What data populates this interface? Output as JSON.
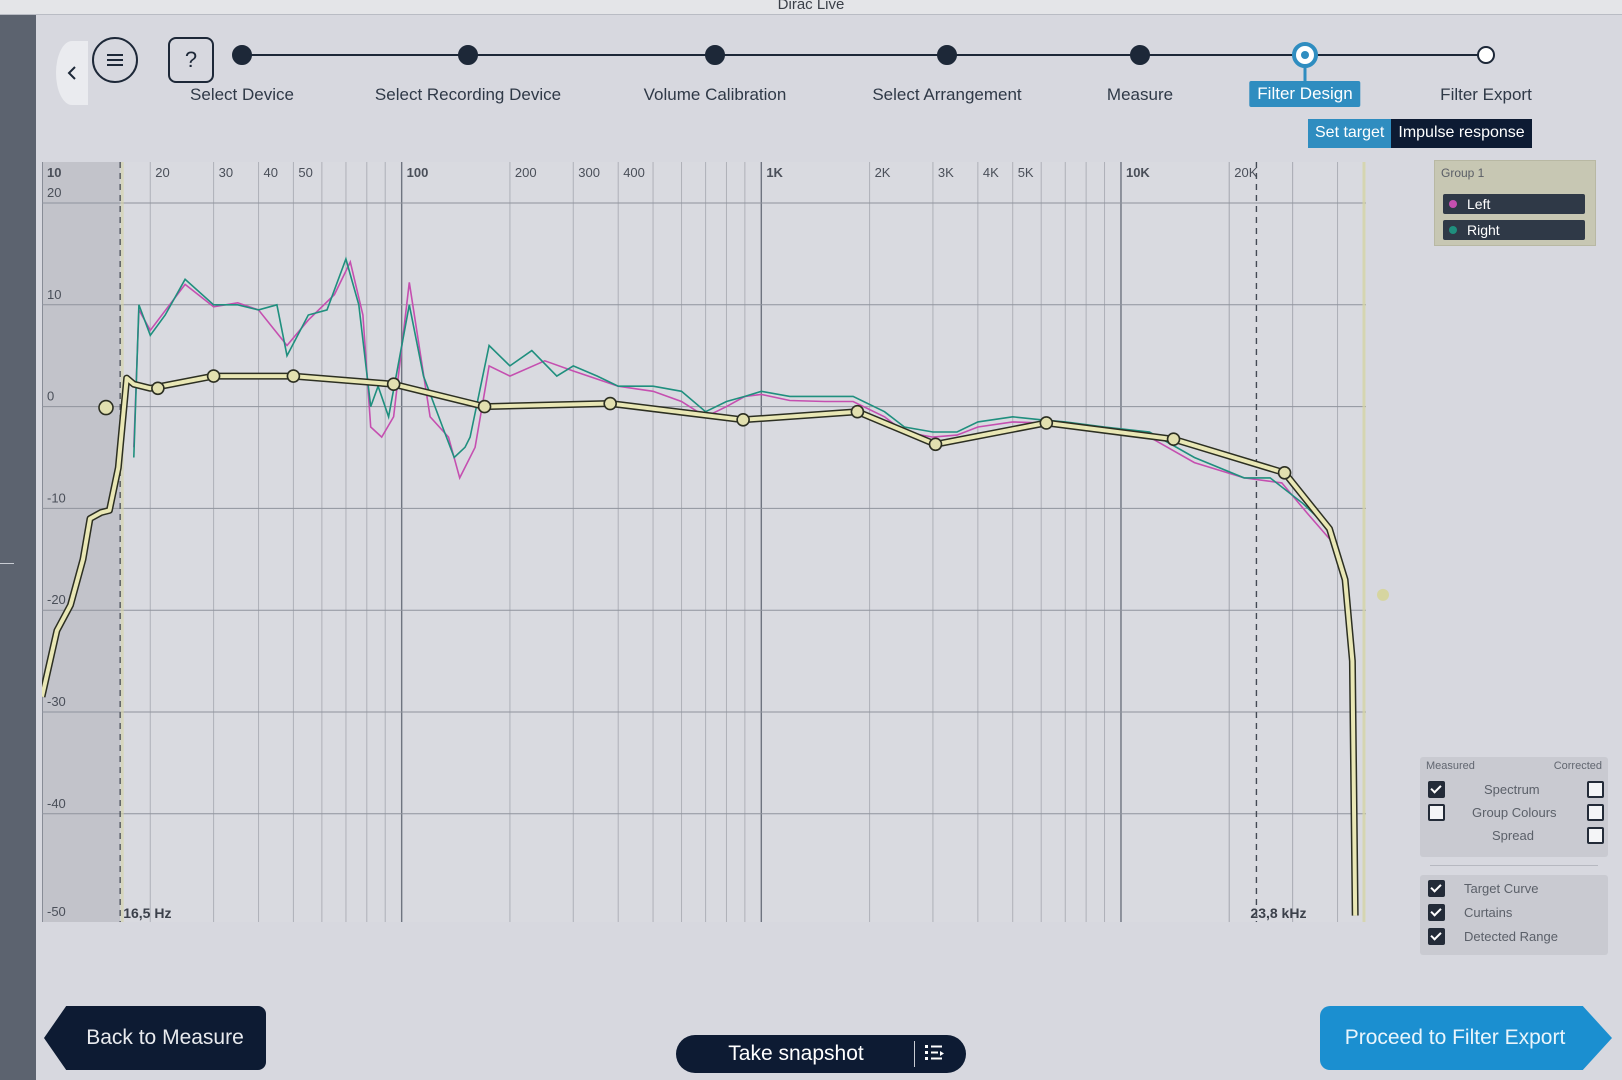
{
  "window": {
    "title": "Dirac Live"
  },
  "steps": [
    {
      "label": "Select Device",
      "state": "done"
    },
    {
      "label": "Select Recording Device",
      "state": "done"
    },
    {
      "label": "Volume Calibration",
      "state": "done"
    },
    {
      "label": "Select Arrangement",
      "state": "done"
    },
    {
      "label": "Measure",
      "state": "done"
    },
    {
      "label": "Filter Design",
      "state": "active"
    },
    {
      "label": "Filter Export",
      "state": "pending"
    }
  ],
  "help_label": "?",
  "subtabs": {
    "target": "Set target",
    "impulse": "Impulse response"
  },
  "graph": {
    "freq_ticks": [
      {
        "label": "10",
        "f": 10,
        "major": true
      },
      {
        "label": "20",
        "f": 20
      },
      {
        "label": "30",
        "f": 30
      },
      {
        "label": "40",
        "f": 40
      },
      {
        "label": "50",
        "f": 50
      },
      {
        "label": "100",
        "f": 100,
        "major": true
      },
      {
        "label": "200",
        "f": 200
      },
      {
        "label": "300",
        "f": 300
      },
      {
        "label": "400",
        "f": 400
      },
      {
        "label": "1K",
        "f": 1000,
        "major": true
      },
      {
        "label": "2K",
        "f": 2000
      },
      {
        "label": "3K",
        "f": 3000
      },
      {
        "label": "4K",
        "f": 4000
      },
      {
        "label": "5K",
        "f": 5000
      },
      {
        "label": "10K",
        "f": 10000,
        "major": true
      },
      {
        "label": "20K",
        "f": 20000
      }
    ],
    "db_ticks": [
      {
        "label": "20",
        "v": 20
      },
      {
        "label": "10",
        "v": 10
      },
      {
        "label": "0",
        "v": 0
      },
      {
        "label": "-10",
        "v": -10
      },
      {
        "label": "-20",
        "v": -20
      },
      {
        "label": "-30",
        "v": -30
      },
      {
        "label": "-40",
        "v": -40
      },
      {
        "label": "-50",
        "v": -50
      }
    ],
    "low_limit_label": "16,5 Hz",
    "high_limit_label": "23,8 kHz",
    "low_limit_hz": 16.5,
    "high_limit_hz": 23800,
    "target_points": [
      [
        21,
        1.8
      ],
      [
        30,
        3
      ],
      [
        50,
        3
      ],
      [
        95,
        2.2
      ],
      [
        170,
        0
      ],
      [
        380,
        0.3
      ],
      [
        890,
        -1.3
      ],
      [
        1850,
        -0.5
      ],
      [
        3050,
        -3.7
      ],
      [
        6200,
        -1.6
      ],
      [
        14000,
        -3.2
      ],
      [
        28500,
        -6.5
      ]
    ],
    "target_curve": [
      [
        10,
        -28.5
      ],
      [
        11,
        -22
      ],
      [
        12,
        -19.5
      ],
      [
        13,
        -15
      ],
      [
        13.6,
        -11
      ],
      [
        14.6,
        -10.4
      ],
      [
        15.4,
        -10.2
      ],
      [
        16.3,
        -6
      ],
      [
        17.2,
        2.8
      ],
      [
        18,
        2.2
      ],
      [
        20,
        1.8
      ],
      [
        30,
        3
      ],
      [
        50,
        3
      ],
      [
        95,
        2.2
      ],
      [
        170,
        0
      ],
      [
        380,
        0.3
      ],
      [
        890,
        -1.3
      ],
      [
        1850,
        -0.5
      ],
      [
        3050,
        -3.7
      ],
      [
        6200,
        -1.6
      ],
      [
        14000,
        -3.2
      ],
      [
        28500,
        -6.5
      ],
      [
        38000,
        -12
      ],
      [
        42000,
        -17
      ],
      [
        44000,
        -25
      ],
      [
        44800,
        -50
      ]
    ],
    "right_curve": [
      [
        18,
        -5
      ],
      [
        18.6,
        10
      ],
      [
        20,
        7
      ],
      [
        22,
        9
      ],
      [
        25,
        12.5
      ],
      [
        30,
        10
      ],
      [
        35,
        10
      ],
      [
        40,
        9.5
      ],
      [
        45,
        10
      ],
      [
        48,
        5
      ],
      [
        55,
        9
      ],
      [
        62,
        9.5
      ],
      [
        70,
        14.5
      ],
      [
        76,
        10
      ],
      [
        82,
        0
      ],
      [
        86,
        2
      ],
      [
        92,
        -1
      ],
      [
        105,
        10
      ],
      [
        115,
        3
      ],
      [
        130,
        -2
      ],
      [
        140,
        -5
      ],
      [
        150,
        -4
      ],
      [
        155,
        -3
      ],
      [
        175,
        6
      ],
      [
        200,
        4
      ],
      [
        230,
        5.5
      ],
      [
        270,
        3
      ],
      [
        300,
        4
      ],
      [
        350,
        3
      ],
      [
        400,
        2
      ],
      [
        500,
        2
      ],
      [
        600,
        1.5
      ],
      [
        700,
        -0.5
      ],
      [
        800,
        0.5
      ],
      [
        900,
        1
      ],
      [
        1000,
        1.5
      ],
      [
        1200,
        1
      ],
      [
        1500,
        1
      ],
      [
        1800,
        1
      ],
      [
        2200,
        -0.5
      ],
      [
        2500,
        -2
      ],
      [
        3000,
        -2.5
      ],
      [
        3500,
        -2.5
      ],
      [
        4000,
        -1.5
      ],
      [
        5000,
        -1
      ],
      [
        6000,
        -1.3
      ],
      [
        7000,
        -1.5
      ],
      [
        9000,
        -2
      ],
      [
        12000,
        -2.5
      ],
      [
        16000,
        -5
      ],
      [
        22000,
        -7
      ],
      [
        26000,
        -7
      ],
      [
        32000,
        -9.5
      ],
      [
        38000,
        -12
      ]
    ],
    "left_curve": [
      [
        18,
        -4
      ],
      [
        18.6,
        9.5
      ],
      [
        20,
        7.5
      ],
      [
        25,
        12
      ],
      [
        30,
        9.8
      ],
      [
        35,
        10.2
      ],
      [
        40,
        9.5
      ],
      [
        48,
        6
      ],
      [
        55,
        8.5
      ],
      [
        65,
        11
      ],
      [
        72,
        14.2
      ],
      [
        78,
        9
      ],
      [
        82,
        -2
      ],
      [
        88,
        -3
      ],
      [
        95,
        -1
      ],
      [
        105,
        12.2
      ],
      [
        120,
        -1
      ],
      [
        135,
        -3
      ],
      [
        145,
        -7
      ],
      [
        160,
        -4
      ],
      [
        175,
        4
      ],
      [
        200,
        3
      ],
      [
        250,
        4.5
      ],
      [
        300,
        3.5
      ],
      [
        400,
        2
      ],
      [
        500,
        1.5
      ],
      [
        600,
        0.5
      ],
      [
        700,
        -1
      ],
      [
        800,
        0
      ],
      [
        900,
        1
      ],
      [
        1000,
        1.2
      ],
      [
        1200,
        0.6
      ],
      [
        1500,
        0.5
      ],
      [
        1800,
        0.5
      ],
      [
        2200,
        -1
      ],
      [
        2500,
        -2.5
      ],
      [
        3000,
        -3
      ],
      [
        3500,
        -2.8
      ],
      [
        4000,
        -2
      ],
      [
        5000,
        -1.5
      ],
      [
        6000,
        -1.6
      ],
      [
        8000,
        -2
      ],
      [
        12000,
        -3
      ],
      [
        16000,
        -5.5
      ],
      [
        22000,
        -7
      ],
      [
        28000,
        -7.5
      ],
      [
        33000,
        -10.5
      ],
      [
        38000,
        -13
      ]
    ]
  },
  "legend": {
    "group_label": "Group 1",
    "items": [
      {
        "label": "Left",
        "color": "#c54fb0"
      },
      {
        "label": "Right",
        "color": "#1f8f7e"
      }
    ]
  },
  "options": {
    "measured_header": "Measured",
    "corrected_header": "Corrected",
    "rows": [
      {
        "label": "Spectrum",
        "measured": true,
        "corrected": false
      },
      {
        "label": "Group Colours",
        "measured": false,
        "corrected": false
      },
      {
        "label": "Spread",
        "corrected": false
      }
    ],
    "toggles": [
      {
        "label": "Target Curve",
        "checked": true
      },
      {
        "label": "Curtains",
        "checked": true
      },
      {
        "label": "Detected Range",
        "checked": true
      }
    ]
  },
  "buttons": {
    "back": "Back to Measure",
    "snapshot": "Take snapshot",
    "proceed": "Proceed to Filter Export"
  },
  "colors": {
    "accent": "#2f8dc0",
    "navy": "#0d1b33",
    "target": "#e9e7b5",
    "left_curve": "#c54fb0",
    "right_curve": "#1f8f7e"
  }
}
